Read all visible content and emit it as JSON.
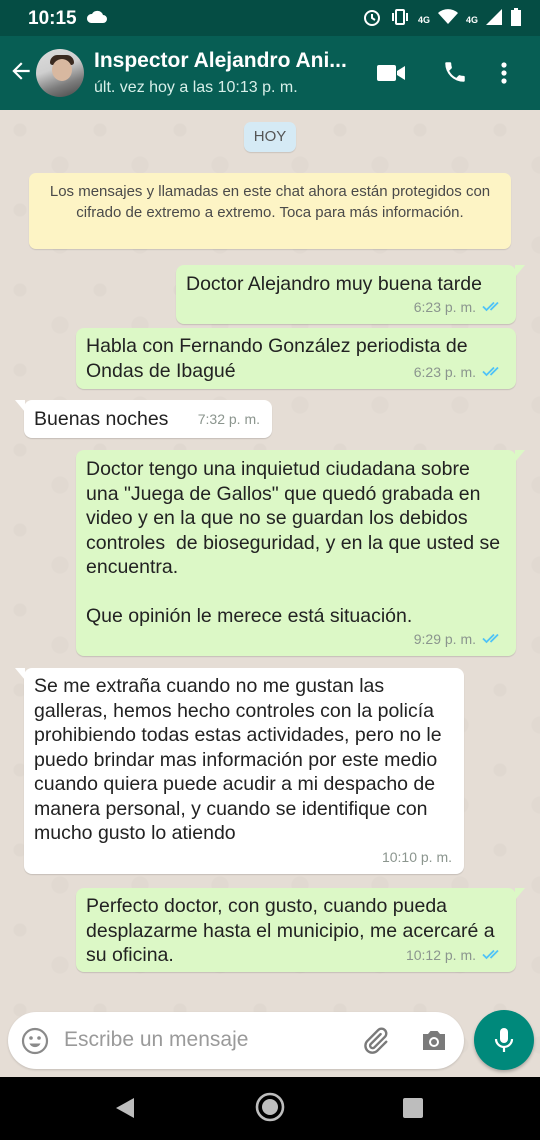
{
  "status_bar": {
    "time": "10:15",
    "net1": "4G",
    "net2": "4G"
  },
  "header": {
    "contact_name": "Inspector Alejandro Ani...",
    "last_seen": "últ. vez hoy a las 10:13 p. m."
  },
  "chat": {
    "date_chip": "HOY",
    "encryption_notice": "Los mensajes y llamadas en este chat ahora están protegidos con cifrado de extremo a extremo. Toca para más información.",
    "messages": [
      {
        "direction": "out",
        "text": "Doctor Alejandro muy buena tarde",
        "time": "6:23 p. m.",
        "status": "read"
      },
      {
        "direction": "out",
        "text": "Habla con Fernando González periodista de Ondas de Ibagué",
        "time": "6:23 p. m.",
        "status": "read"
      },
      {
        "direction": "in",
        "text": "Buenas noches",
        "time": "7:32 p. m."
      },
      {
        "direction": "out",
        "text": "Doctor tengo una inquietud ciudadana sobre una \"Juega de Gallos\" que quedó grabada en video y en la que no se guardan los debidos controles  de bioseguridad, y en la que usted se encuentra.\n\nQue opinión le merece está situación.",
        "time": "9:29 p. m.",
        "status": "read"
      },
      {
        "direction": "in",
        "text": "Se me extraña cuando no me gustan las galleras, hemos hecho controles con la policía prohibiendo todas estas actividades, pero no le puedo brindar mas información por este medio cuando quiera puede acudir a mi despacho de manera personal, y cuando se identifique con mucho gusto lo atiendo",
        "time": "10:10 p. m."
      },
      {
        "direction": "out",
        "text": "Perfecto doctor, con gusto, cuando pueda desplazarme hasta el municipio, me acercaré a su oficina.",
        "time": "10:12 p. m.",
        "status": "read"
      }
    ]
  },
  "composer": {
    "placeholder": "Escribe un mensaje"
  },
  "colors": {
    "header": "#075e54",
    "status_bar": "#054d44",
    "outgoing_bubble": "#dcf8c6",
    "incoming_bubble": "#ffffff",
    "read_ticks": "#4fc3f7",
    "mic_button": "#00897b"
  },
  "icons": [
    "back-arrow-icon",
    "video-call-icon",
    "phone-icon",
    "more-vert-icon",
    "emoji-icon",
    "attach-icon",
    "camera-icon",
    "mic-icon",
    "nav-back-icon",
    "nav-home-icon",
    "nav-recents-icon"
  ]
}
